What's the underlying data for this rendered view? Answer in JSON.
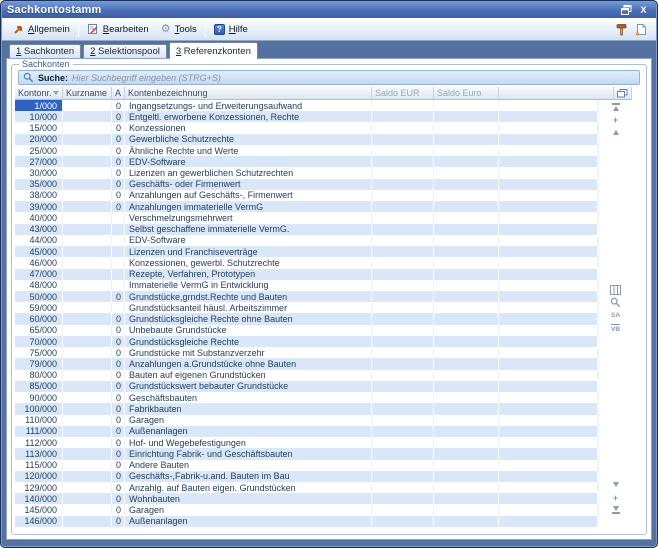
{
  "window": {
    "title": "Sachkontostamm",
    "controls": {
      "close_glyph": "X"
    }
  },
  "toolbar": {
    "items": [
      {
        "label": "Allgemein",
        "icon": "arrow-up-right-icon"
      },
      {
        "label": "Bearbeiten",
        "icon": "edit-note-icon"
      },
      {
        "label": "Tools",
        "icon": "gear-icon"
      },
      {
        "label": "Hilfe",
        "icon": "help-icon",
        "help_glyph": "?"
      }
    ],
    "right_icons": [
      "hammer-icon",
      "new-document-icon"
    ]
  },
  "tabs": [
    {
      "label": "1 Sachkonten"
    },
    {
      "label": "2 Selektionspool"
    },
    {
      "label": "3 Referenzkonten"
    }
  ],
  "groupbox": {
    "label": "Sachkonten"
  },
  "search": {
    "label": "Suche:",
    "placeholder": "Hier Suchbegriff eingeben (STRG+S)"
  },
  "table": {
    "columns": {
      "nr": "Kontonr.",
      "kurzname": "Kurzname",
      "a": "A",
      "name": "Kontenbezeichnung",
      "saldo_eur": "Saldo EUR",
      "saldo_euro": "Saldo Euro"
    },
    "rows": [
      {
        "nr": "1/000",
        "kurzname": "",
        "a": "0",
        "name": "Ingangsetzungs- und Erweiterungsaufwand",
        "selected": true
      },
      {
        "nr": "10/000",
        "kurzname": "",
        "a": "0",
        "name": "Entgeltl. erworbene Konzessionen, Rechte"
      },
      {
        "nr": "15/000",
        "kurzname": "",
        "a": "0",
        "name": "Konzessionen"
      },
      {
        "nr": "20/000",
        "kurzname": "",
        "a": "0",
        "name": "Gewerbliche Schutzrechte"
      },
      {
        "nr": "25/000",
        "kurzname": "",
        "a": "0",
        "name": "Ähnliche Rechte und Werte"
      },
      {
        "nr": "27/000",
        "kurzname": "",
        "a": "0",
        "name": "EDV-Software"
      },
      {
        "nr": "30/000",
        "kurzname": "",
        "a": "0",
        "name": "Lizenzen an gewerblichen Schutzrechten"
      },
      {
        "nr": "35/000",
        "kurzname": "",
        "a": "0",
        "name": "Geschäfts- oder Firmenwert"
      },
      {
        "nr": "38/000",
        "kurzname": "",
        "a": "0",
        "name": "Anzahlungen auf Geschäfts-, Firmenwert"
      },
      {
        "nr": "39/000",
        "kurzname": "",
        "a": "0",
        "name": "Anzahlungen immaterielle VermG"
      },
      {
        "nr": "40/000",
        "kurzname": "",
        "a": "",
        "name": "Verschmelzungsmehrwert"
      },
      {
        "nr": "43/000",
        "kurzname": "",
        "a": "",
        "name": "Selbst geschaffene immaterielle VermG."
      },
      {
        "nr": "44/000",
        "kurzname": "",
        "a": "",
        "name": "EDV-Software"
      },
      {
        "nr": "45/000",
        "kurzname": "",
        "a": "",
        "name": "Lizenzen und Franchiseverträge"
      },
      {
        "nr": "46/000",
        "kurzname": "",
        "a": "",
        "name": "Konzessionen, gewerbl. Schutzrechte"
      },
      {
        "nr": "47/000",
        "kurzname": "",
        "a": "",
        "name": "Rezepte, Verfahren, Prototypen"
      },
      {
        "nr": "48/000",
        "kurzname": "",
        "a": "",
        "name": "Immaterielle VermG in Entwicklung"
      },
      {
        "nr": "50/000",
        "kurzname": "",
        "a": "0",
        "name": "Grundstücke,grndst.Rechte und Bauten"
      },
      {
        "nr": "59/000",
        "kurzname": "",
        "a": "",
        "name": "Grundstücksanteil häusl. Arbeitszimmer"
      },
      {
        "nr": "60/000",
        "kurzname": "",
        "a": "0",
        "name": "Grundstücksgleiche Rechte ohne Bauten"
      },
      {
        "nr": "65/000",
        "kurzname": "",
        "a": "0",
        "name": "Unbebaute Grundstücke"
      },
      {
        "nr": "70/000",
        "kurzname": "",
        "a": "0",
        "name": "Grundstücksgleiche Rechte"
      },
      {
        "nr": "75/000",
        "kurzname": "",
        "a": "0",
        "name": "Grundstücke mit Substanzverzehr"
      },
      {
        "nr": "79/000",
        "kurzname": "",
        "a": "0",
        "name": "Anzahlungen a.Grundstücke ohne Bauten"
      },
      {
        "nr": "80/000",
        "kurzname": "",
        "a": "0",
        "name": "Bauten auf eigenen Grundstücken"
      },
      {
        "nr": "85/000",
        "kurzname": "",
        "a": "0",
        "name": "Grundstückswert bebauter Grundstücke"
      },
      {
        "nr": "90/000",
        "kurzname": "",
        "a": "0",
        "name": "Geschäftsbauten"
      },
      {
        "nr": "100/000",
        "kurzname": "",
        "a": "0",
        "name": "Fabrikbauten"
      },
      {
        "nr": "110/000",
        "kurzname": "",
        "a": "0",
        "name": "Garagen"
      },
      {
        "nr": "111/000",
        "kurzname": "",
        "a": "0",
        "name": "Außenanlagen"
      },
      {
        "nr": "112/000",
        "kurzname": "",
        "a": "0",
        "name": "Hof- und Wegebefestigungen"
      },
      {
        "nr": "113/000",
        "kurzname": "",
        "a": "0",
        "name": "Einrichtung Fabrik- und Geschäftsbauten"
      },
      {
        "nr": "115/000",
        "kurzname": "",
        "a": "0",
        "name": "Andere Bauten"
      },
      {
        "nr": "120/000",
        "kurzname": "",
        "a": "0",
        "name": "Geschäfts-,Fabrik-u.and. Bauten im Bau"
      },
      {
        "nr": "129/000",
        "kurzname": "",
        "a": "0",
        "name": "Anzahlg. auf Bauten eigen. Grundstücken"
      },
      {
        "nr": "140/000",
        "kurzname": "",
        "a": "0",
        "name": "Wohnbauten"
      },
      {
        "nr": "145/000",
        "kurzname": "",
        "a": "0",
        "name": "Garagen"
      },
      {
        "nr": "146/000",
        "kurzname": "",
        "a": "0",
        "name": "Außenanlagen"
      }
    ]
  },
  "rail": {
    "sa_label": "SA",
    "vb_label": "VB"
  },
  "colors": {
    "titlebar_top": "#7396d6",
    "titlebar_bottom": "#3a5fa6",
    "frame": "#54719f",
    "selection": "#2e63c4",
    "row_stripe": "#d9e7f8",
    "accent_orange": "#b65c1e"
  }
}
